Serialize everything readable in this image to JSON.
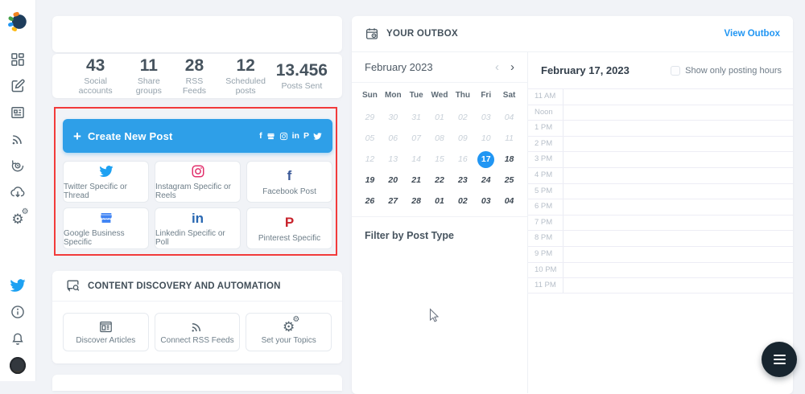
{
  "sidebar": {
    "logo": "socialbee-logo",
    "top_icons": [
      "dashboard-grid-icon",
      "compose-icon",
      "news-icon",
      "rss-icon",
      "sync-clock-icon",
      "cloud-download-icon",
      "gears-icon"
    ],
    "bottom_icons": [
      "twitter-icon",
      "info-icon",
      "bell-icon",
      "avatar"
    ]
  },
  "stats": [
    {
      "value": "43",
      "label": "Social accounts"
    },
    {
      "value": "11",
      "label": "Share groups"
    },
    {
      "value": "28",
      "label": "RSS Feeds"
    },
    {
      "value": "12",
      "label": "Scheduled posts"
    },
    {
      "value": "13.456",
      "label": "Posts Sent"
    }
  ],
  "create_post": {
    "plus": "+",
    "label": "Create New Post",
    "icons": [
      "facebook-icon",
      "google-business-icon",
      "instagram-icon",
      "linkedin-icon",
      "pinterest-icon",
      "twitter-icon"
    ]
  },
  "post_types": [
    {
      "icon": "twitter-icon",
      "color": "#1da1f2",
      "label": "Twitter Specific or Thread"
    },
    {
      "icon": "instagram-icon",
      "color": "#e1306c",
      "label": "Instagram Specific or Reels"
    },
    {
      "icon": "facebook-icon",
      "color": "#3b5998",
      "label": "Facebook Post"
    },
    {
      "icon": "google-business-icon",
      "color": "#4285f4",
      "label": "Google Business Specific"
    },
    {
      "icon": "linkedin-icon",
      "color": "#2867b2",
      "label": "Linkedin Specific or Poll"
    },
    {
      "icon": "pinterest-icon",
      "color": "#c8232c",
      "label": "Pinterest Specific"
    }
  ],
  "discovery": {
    "icon": "content-search-icon",
    "title": "CONTENT DISCOVERY AND AUTOMATION",
    "cards": [
      {
        "icon": "discover-articles-icon",
        "label": "Discover Articles"
      },
      {
        "icon": "rss-icon",
        "label": "Connect RSS Feeds"
      },
      {
        "icon": "gears-icon",
        "label": "Set your Topics"
      }
    ]
  },
  "outbox": {
    "icon": "calendar-clock-icon",
    "title": "YOUR OUTBOX",
    "view_link": "View Outbox",
    "calendar": {
      "month_label": "February 2023",
      "prev_icon": "‹",
      "next_icon": "›",
      "day_headers": [
        "Sun",
        "Mon",
        "Tue",
        "Wed",
        "Thu",
        "Fri",
        "Sat"
      ],
      "days": [
        {
          "n": "29",
          "state": "muted"
        },
        {
          "n": "30",
          "state": "muted"
        },
        {
          "n": "31",
          "state": "muted"
        },
        {
          "n": "01",
          "state": "muted"
        },
        {
          "n": "02",
          "state": "muted"
        },
        {
          "n": "03",
          "state": "muted"
        },
        {
          "n": "04",
          "state": "muted"
        },
        {
          "n": "05",
          "state": "muted"
        },
        {
          "n": "06",
          "state": "muted"
        },
        {
          "n": "07",
          "state": "muted"
        },
        {
          "n": "08",
          "state": "muted"
        },
        {
          "n": "09",
          "state": "muted"
        },
        {
          "n": "10",
          "state": "muted"
        },
        {
          "n": "11",
          "state": "muted"
        },
        {
          "n": "12",
          "state": "muted"
        },
        {
          "n": "13",
          "state": "muted"
        },
        {
          "n": "14",
          "state": "muted"
        },
        {
          "n": "15",
          "state": "muted"
        },
        {
          "n": "16",
          "state": "muted"
        },
        {
          "n": "17",
          "state": "selected"
        },
        {
          "n": "18",
          "state": "active"
        },
        {
          "n": "19",
          "state": "active"
        },
        {
          "n": "20",
          "state": "active"
        },
        {
          "n": "21",
          "state": "active"
        },
        {
          "n": "22",
          "state": "active"
        },
        {
          "n": "23",
          "state": "active"
        },
        {
          "n": "24",
          "state": "active"
        },
        {
          "n": "25",
          "state": "active"
        },
        {
          "n": "26",
          "state": "active"
        },
        {
          "n": "27",
          "state": "active"
        },
        {
          "n": "28",
          "state": "active"
        },
        {
          "n": "01",
          "state": "active"
        },
        {
          "n": "02",
          "state": "active"
        },
        {
          "n": "03",
          "state": "active"
        },
        {
          "n": "04",
          "state": "active"
        }
      ]
    },
    "filter_label": "Filter by Post Type",
    "day_view": {
      "date_label": "February 17, 2023",
      "checkbox_label": "Show only posting hours",
      "checkbox_checked": false,
      "times": [
        "11 AM",
        "Noon",
        "1 PM",
        "2 PM",
        "3 PM",
        "4 PM",
        "5 PM",
        "6 PM",
        "7 PM",
        "8 PM",
        "9 PM",
        "10 PM",
        "11 PM"
      ]
    }
  },
  "fab": {
    "icon": "menu-icon"
  },
  "colors": {
    "accent_blue": "#2e9fe8",
    "link_blue": "#2196f3",
    "annotation_red": "#f23b3b",
    "selected_day_blue": "#2196f3",
    "twitter": "#1da1f2",
    "instagram": "#e1306c",
    "facebook": "#3b5998",
    "google_business": "#4285f4",
    "linkedin": "#2867b2",
    "pinterest": "#c8232c"
  }
}
